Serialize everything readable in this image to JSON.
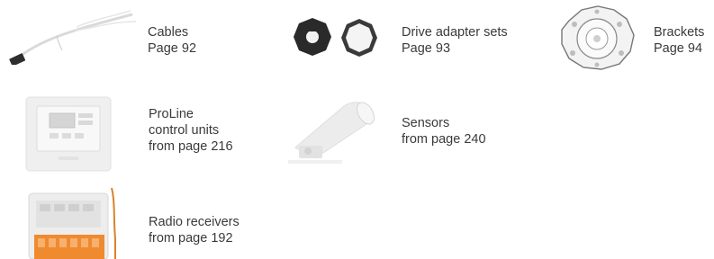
{
  "items": [
    {
      "name": "cables",
      "lines": [
        "Cables",
        "Page 92"
      ],
      "icon": "cable-icon"
    },
    {
      "name": "drive-adapter-sets",
      "lines": [
        "Drive adapter sets",
        "Page 93"
      ],
      "icon": "drive-adapter-icon"
    },
    {
      "name": "brackets",
      "lines": [
        "Brackets",
        "Page 94"
      ],
      "icon": "bracket-icon"
    },
    {
      "name": "proline-control-units",
      "lines": [
        "ProLine",
        "control units",
        "from page 216"
      ],
      "icon": "control-unit-icon"
    },
    {
      "name": "sensors",
      "lines": [
        "Sensors",
        "from page 240"
      ],
      "icon": "sensor-icon"
    },
    {
      "name": "radio-receivers",
      "lines": [
        "Radio receivers",
        "from page 192"
      ],
      "icon": "radio-receiver-icon"
    }
  ]
}
